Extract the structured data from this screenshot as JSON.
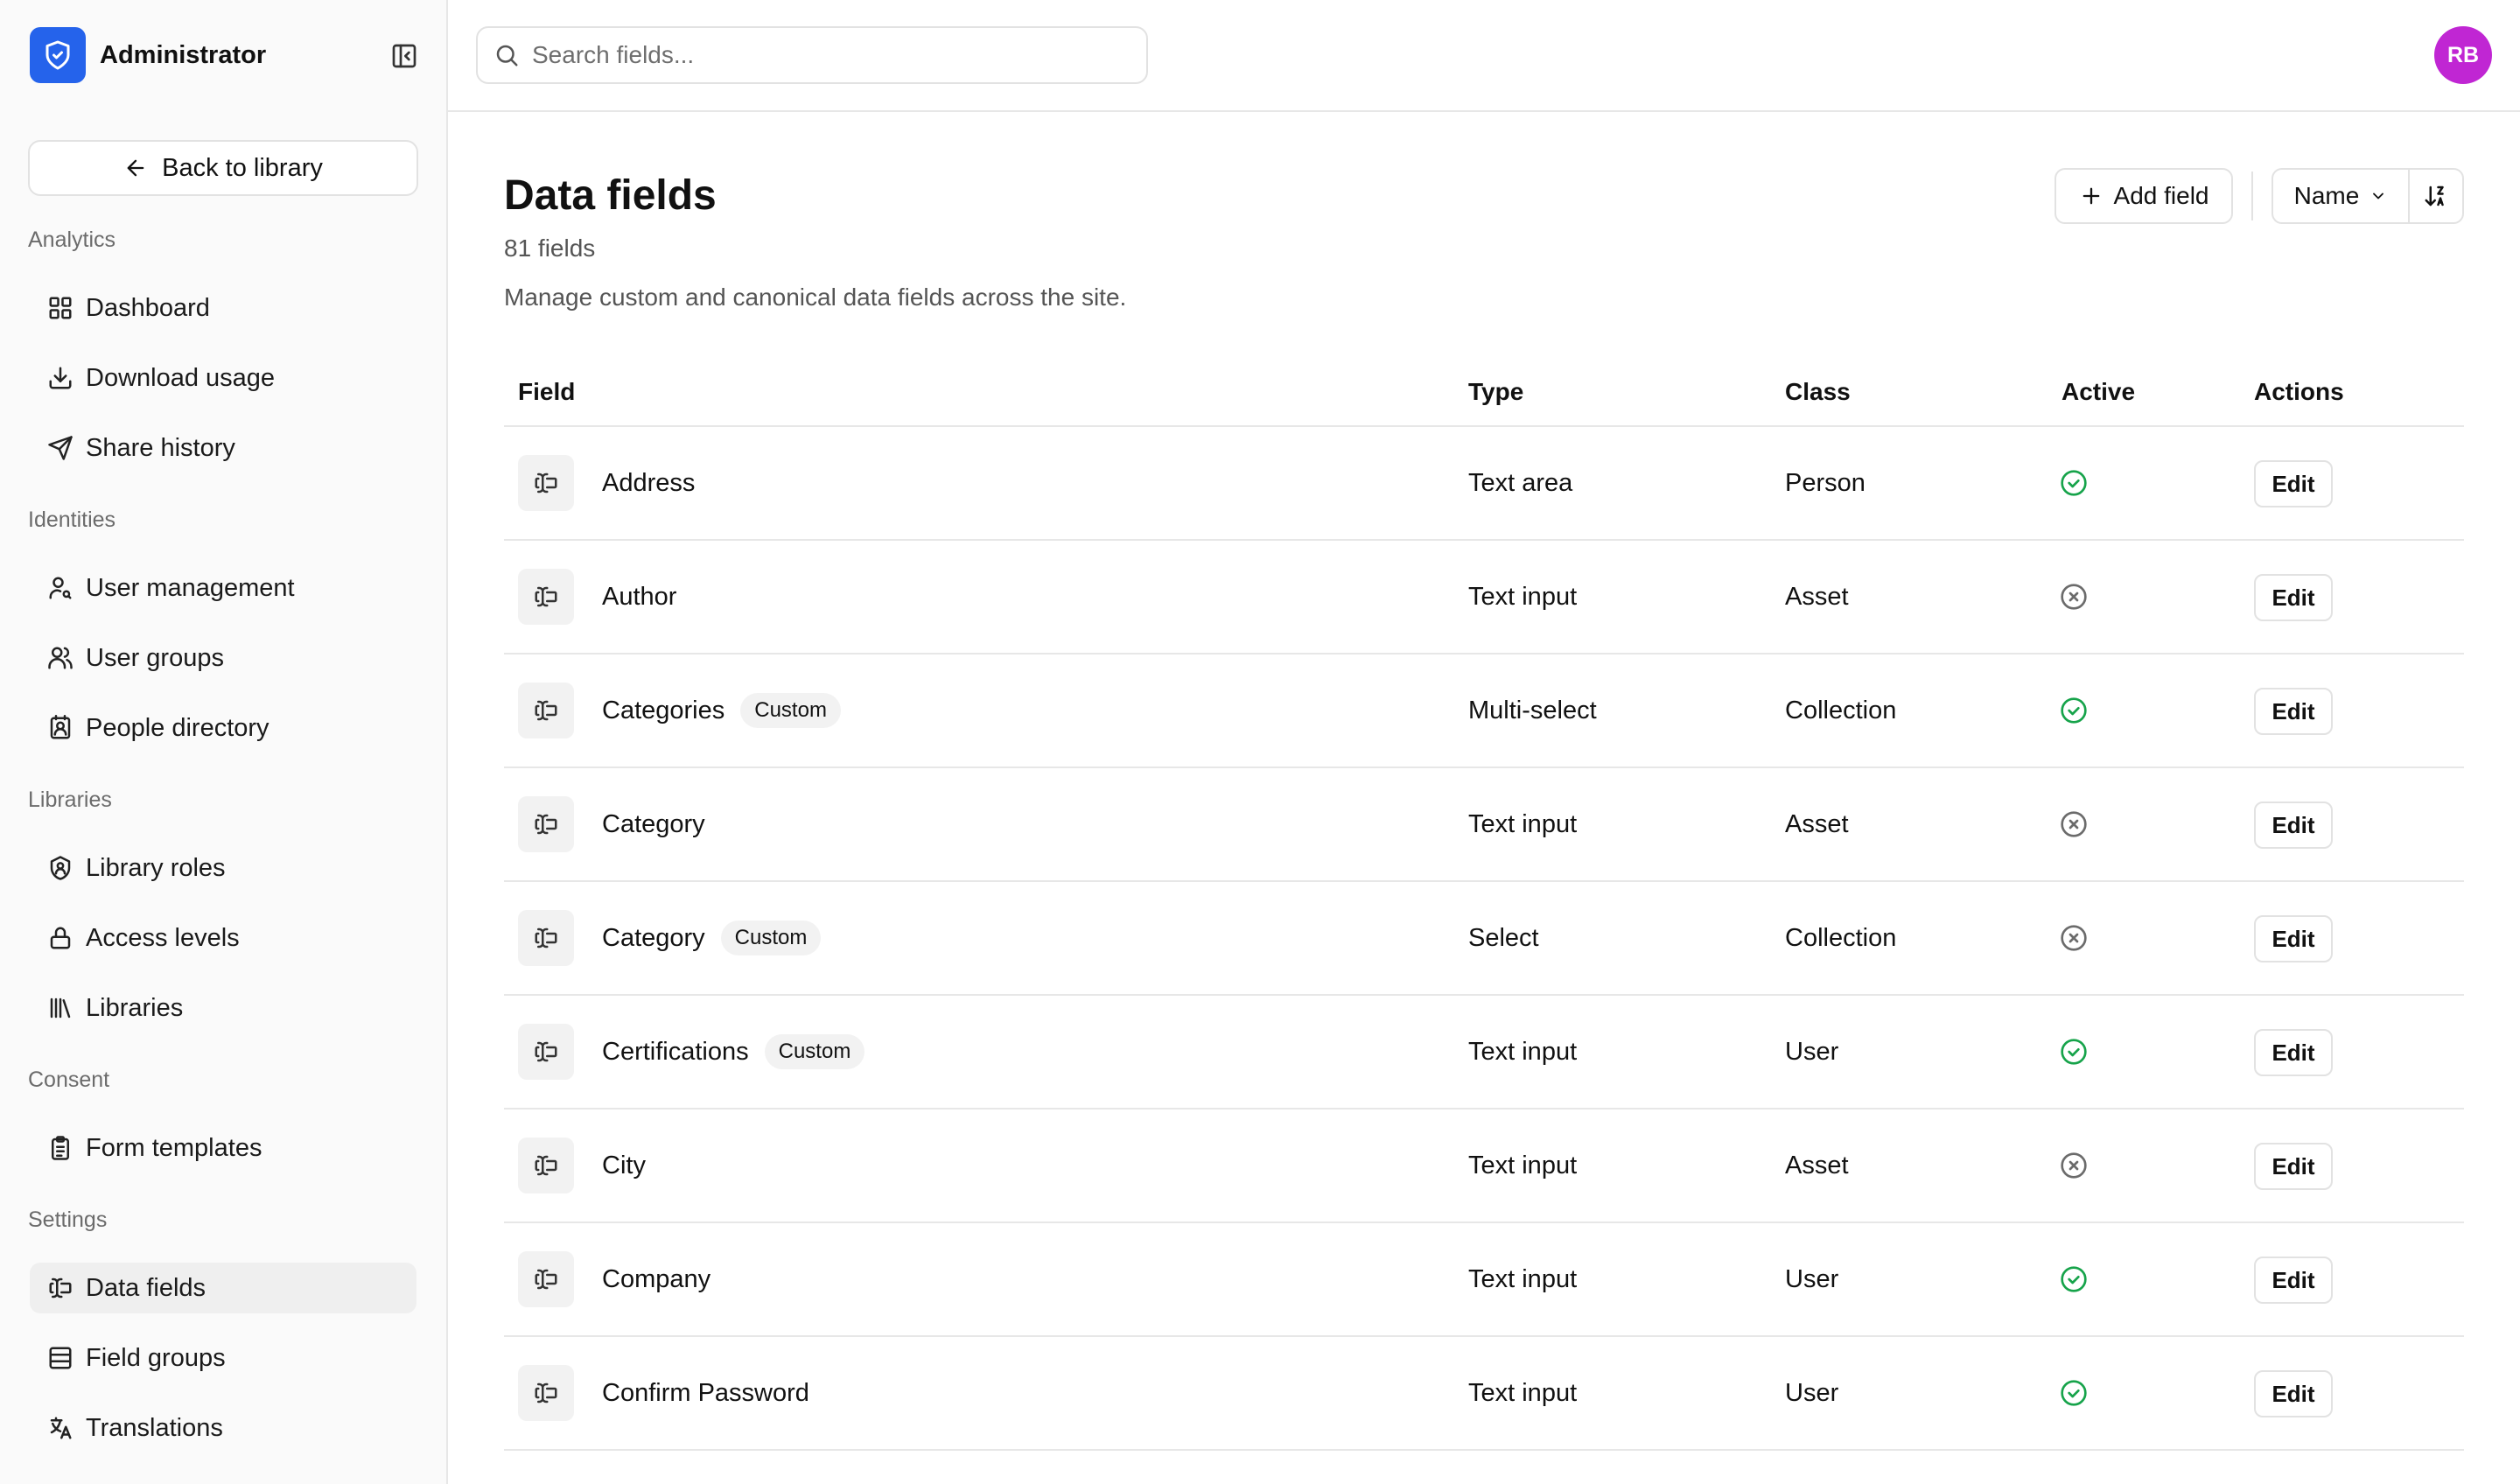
{
  "brand": {
    "name": "Administrator"
  },
  "sidebar": {
    "back_label": "Back to library",
    "sections": [
      {
        "label": "Analytics",
        "items": [
          {
            "label": "Dashboard",
            "icon": "grid-icon"
          },
          {
            "label": "Download usage",
            "icon": "download-icon"
          },
          {
            "label": "Share history",
            "icon": "send-icon"
          }
        ]
      },
      {
        "label": "Identities",
        "items": [
          {
            "label": "User management",
            "icon": "user-search-icon"
          },
          {
            "label": "User groups",
            "icon": "users-icon"
          },
          {
            "label": "People directory",
            "icon": "contact-icon"
          }
        ]
      },
      {
        "label": "Libraries",
        "items": [
          {
            "label": "Library roles",
            "icon": "shield-user-icon"
          },
          {
            "label": "Access levels",
            "icon": "lock-icon"
          },
          {
            "label": "Libraries",
            "icon": "library-icon"
          }
        ]
      },
      {
        "label": "Consent",
        "items": [
          {
            "label": "Form templates",
            "icon": "clipboard-icon"
          }
        ]
      },
      {
        "label": "Settings",
        "items": [
          {
            "label": "Data fields",
            "icon": "text-cursor-input-icon",
            "active": true
          },
          {
            "label": "Field groups",
            "icon": "rows-icon"
          },
          {
            "label": "Translations",
            "icon": "languages-icon"
          }
        ]
      }
    ]
  },
  "search": {
    "placeholder": "Search fields..."
  },
  "user": {
    "initials": "RB",
    "avatar_color": "#c026d3"
  },
  "header": {
    "title": "Data fields",
    "count": "81 fields",
    "description": "Manage custom and canonical data fields across the site.",
    "add_label": "Add field",
    "sort_label": "Name"
  },
  "table": {
    "columns": {
      "field": "Field",
      "type": "Type",
      "class": "Class",
      "active": "Active",
      "actions": "Actions"
    },
    "edit_label": "Edit",
    "rows": [
      {
        "name": "Address",
        "badge": "",
        "type": "Text area",
        "class": "Person",
        "active": true
      },
      {
        "name": "Author",
        "badge": "",
        "type": "Text input",
        "class": "Asset",
        "active": false
      },
      {
        "name": "Categories",
        "badge": "Custom",
        "type": "Multi-select",
        "class": "Collection",
        "active": true
      },
      {
        "name": "Category",
        "badge": "",
        "type": "Text input",
        "class": "Asset",
        "active": false
      },
      {
        "name": "Category",
        "badge": "Custom",
        "type": "Select",
        "class": "Collection",
        "active": false
      },
      {
        "name": "Certifications",
        "badge": "Custom",
        "type": "Text input",
        "class": "User",
        "active": true
      },
      {
        "name": "City",
        "badge": "",
        "type": "Text input",
        "class": "Asset",
        "active": false
      },
      {
        "name": "Company",
        "badge": "",
        "type": "Text input",
        "class": "User",
        "active": true
      },
      {
        "name": "Confirm Password",
        "badge": "",
        "type": "Text input",
        "class": "User",
        "active": true
      }
    ]
  },
  "colors": {
    "brand": "#2563eb",
    "active": "#16a34a",
    "inactive": "#6b6b6b"
  }
}
